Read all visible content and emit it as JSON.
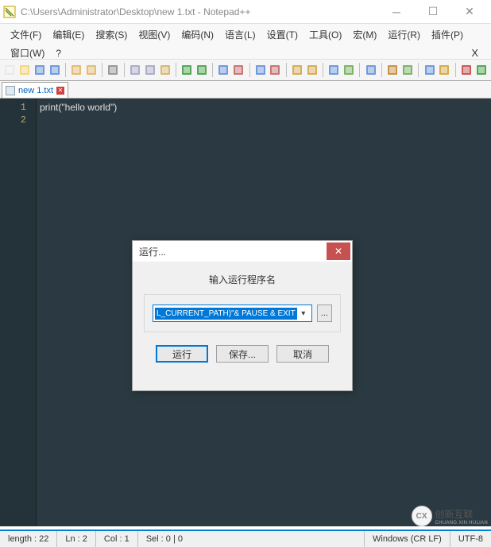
{
  "window": {
    "title": "C:\\Users\\Administrator\\Desktop\\new 1.txt - Notepad++"
  },
  "menu": {
    "items": [
      "文件(F)",
      "编辑(E)",
      "搜索(S)",
      "视图(V)",
      "编码(N)",
      "语言(L)",
      "设置(T)",
      "工具(O)",
      "宏(M)",
      "运行(R)",
      "插件(P)",
      "窗口(W)",
      "?"
    ]
  },
  "toolbar_icons": [
    "new-file-icon",
    "open-file-icon",
    "save-icon",
    "save-all-icon",
    "sep",
    "close-icon",
    "close-all-icon",
    "sep",
    "print-icon",
    "sep",
    "cut-icon",
    "copy-icon",
    "paste-icon",
    "sep",
    "undo-icon",
    "redo-icon",
    "sep",
    "find-icon",
    "replace-icon",
    "sep",
    "zoom-in-icon",
    "zoom-out-icon",
    "sep",
    "sync-v-icon",
    "sync-h-icon",
    "sep",
    "wrap-icon",
    "show-all-icon",
    "sep",
    "indent-guide-icon",
    "sep",
    "lang-icon",
    "doc-map-icon",
    "sep",
    "function-list-icon",
    "folder-icon",
    "sep",
    "record-icon",
    "play-icon"
  ],
  "tab": {
    "name": "new 1.txt"
  },
  "code": {
    "lines": [
      "print(\"hello world\")",
      ""
    ]
  },
  "dialog": {
    "title": "运行...",
    "label": "输入运行程序名",
    "value": "L_CURRENT_PATH)\"& PAUSE & EXIT",
    "browse": "...",
    "run": "运行",
    "save": "保存...",
    "cancel": "取消"
  },
  "status": {
    "length": "length : 22",
    "ln": "Ln : 2",
    "col": "Col : 1",
    "sel": "Sel : 0 | 0",
    "eol": "Windows (CR LF)",
    "encoding": "UTF-8"
  },
  "watermark": {
    "text": "创新互联",
    "sub": "CHUANG XIN HULIAN"
  }
}
